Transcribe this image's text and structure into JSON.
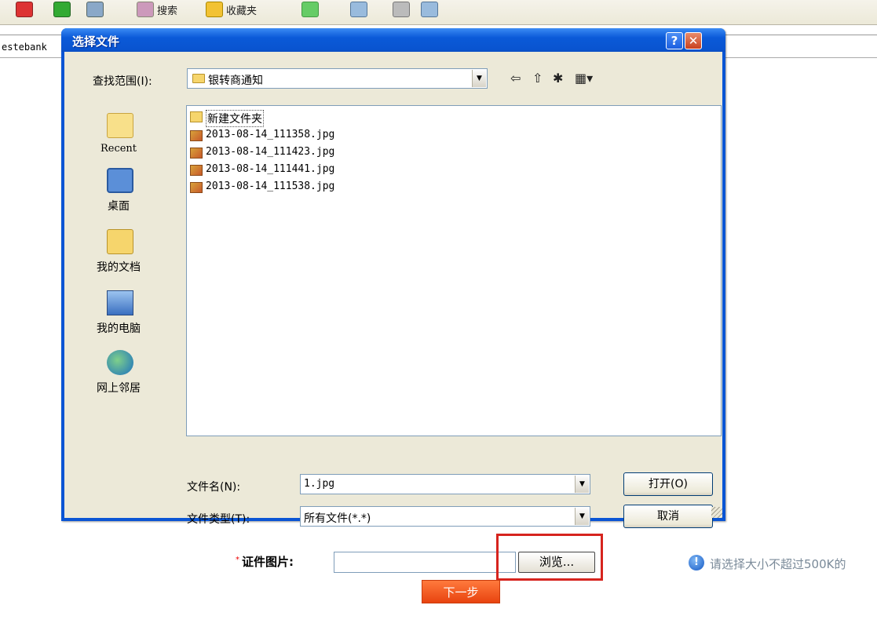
{
  "toolbar": {
    "search_label": "搜索",
    "favorites_label": "收藏夹"
  },
  "address": {
    "text": "estebank"
  },
  "dialog": {
    "title": "选择文件",
    "help_label": "?",
    "close_label": "✕",
    "lookin_label": "查找范围(I):",
    "lookin_value": "银转商通知",
    "places": [
      {
        "label": "Recent",
        "icon": "recent-icon"
      },
      {
        "label": "桌面",
        "icon": "desktop-icon"
      },
      {
        "label": "我的文档",
        "icon": "my-documents-icon"
      },
      {
        "label": "我的电脑",
        "icon": "my-computer-icon"
      },
      {
        "label": "网上邻居",
        "icon": "network-places-icon"
      }
    ],
    "files": [
      {
        "name": "新建文件夹",
        "type": "folder"
      },
      {
        "name": "2013-08-14_111358.jpg",
        "type": "jpg"
      },
      {
        "name": "2013-08-14_111423.jpg",
        "type": "jpg"
      },
      {
        "name": "2013-08-14_111441.jpg",
        "type": "jpg"
      },
      {
        "name": "2013-08-14_111538.jpg",
        "type": "jpg"
      }
    ],
    "filename_label": "文件名(N):",
    "filename_value": "1.jpg",
    "filetype_label": "文件类型(T):",
    "filetype_value": "所有文件(*.*)",
    "open_label": "打开(O)",
    "cancel_label": "取消"
  },
  "form": {
    "cert_label": "证件图片:",
    "required_mark": "*",
    "browse_label": "浏览...",
    "hint": "请选择大小不超过500K的",
    "next_label": "下一步"
  },
  "colors": {
    "titlebar": "#0a55d4",
    "highlight_box": "#d6241e",
    "next_button": "#e8430f"
  }
}
